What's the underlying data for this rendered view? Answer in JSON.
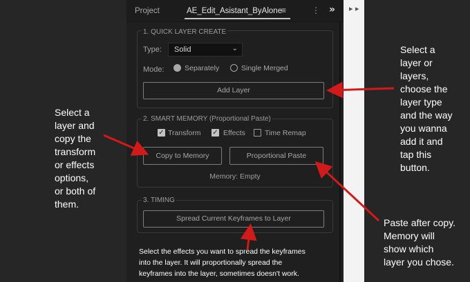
{
  "panel": {
    "tabs": {
      "project": "Project",
      "active": "AE_Edit_Asistant_ByAlone"
    },
    "icons": {
      "tab_menu": "hamburger-menu-icon",
      "kebab": "vertical-ellipsis-icon",
      "overflow": "double-chevron-right-icon"
    }
  },
  "quick_layer": {
    "title": "1. QUICK LAYER CREATE",
    "type_label": "Type:",
    "type_value": "Solid",
    "mode_label": "Mode:",
    "mode_options": [
      "Separately",
      "Single Merged"
    ],
    "mode_selected": "Separately",
    "add_button": "Add Layer"
  },
  "smart_memory": {
    "title": "2. SMART MEMORY (Proportional Paste)",
    "checkboxes": [
      {
        "label": "Transform",
        "checked": true
      },
      {
        "label": "Effects",
        "checked": true
      },
      {
        "label": "Time Remap",
        "checked": false
      }
    ],
    "copy_button": "Copy to Memory",
    "paste_button": "Proportional Paste",
    "memory_status": "Memory: Empty"
  },
  "timing": {
    "title": "3. TIMING",
    "spread_button": "Spread Current Keyframes to Layer"
  },
  "annotations": {
    "left": "Select a\nlayer and\ncopy the\ntransform\nor effects\noptions,\nor both of\nthem.",
    "right": "Select a\nlayer or\nlayers,\nchoose the\nlayer type\nand the way\nyou wanna\nadd it and\ntap this\nbutton.",
    "paste": "Paste after copy.\nMemory will\nshow which\nlayer you chose.",
    "bottom": "Select the effects you want to spread the keyframes\ninto the layer. It will proportionally spread the\nkeyframes into the layer, sometimes doesn't work."
  },
  "colors": {
    "arrow": "#d11a1a",
    "panel_bg": "#1f1f1f",
    "page_bg": "#262626"
  }
}
